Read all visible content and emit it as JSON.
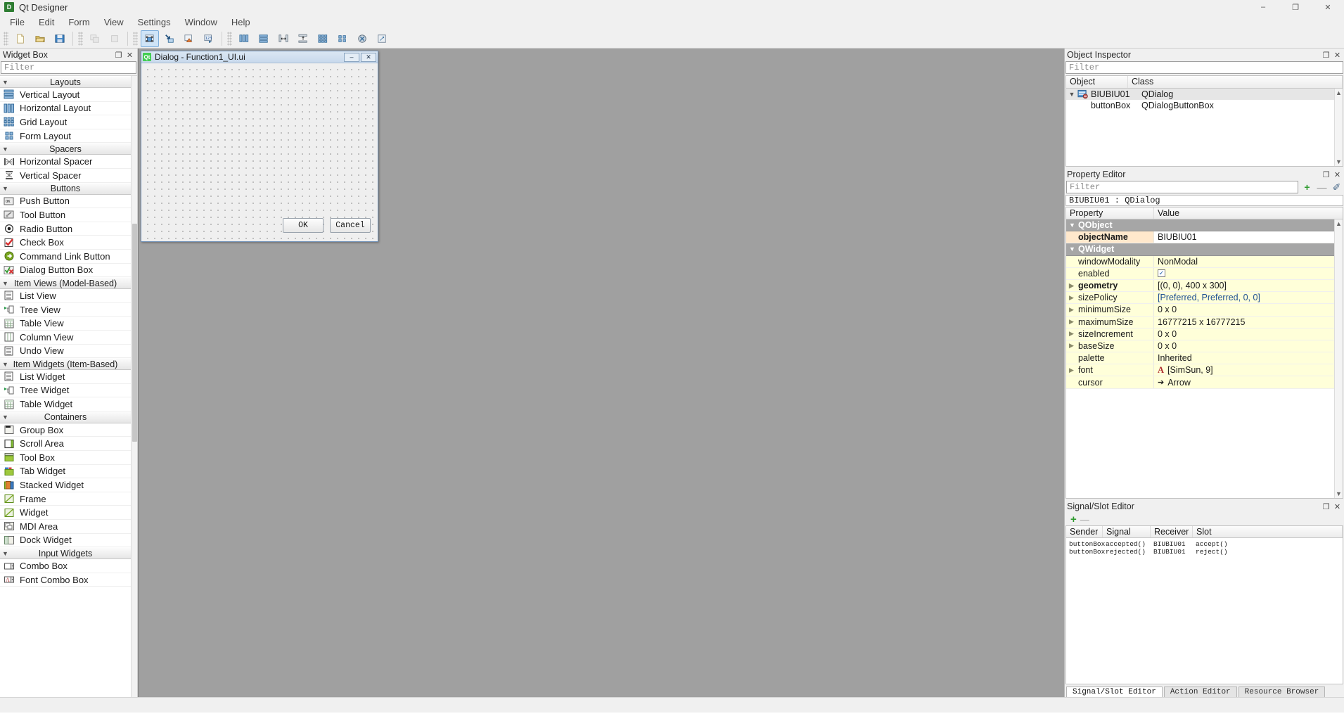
{
  "window": {
    "title": "Qt Designer",
    "icon": "qt-designer-icon",
    "badge_text": "D",
    "controls": {
      "minimize": "–",
      "maximize": "❐",
      "close": "✕"
    }
  },
  "menubar": {
    "items": [
      {
        "label": "File"
      },
      {
        "label": "Edit"
      },
      {
        "label": "Form"
      },
      {
        "label": "View"
      },
      {
        "label": "Settings"
      },
      {
        "label": "Window"
      },
      {
        "label": "Help"
      }
    ]
  },
  "toolbar": {
    "groups": [
      {
        "buttons": [
          {
            "name": "new-form-icon",
            "title": "New"
          },
          {
            "name": "open-form-icon",
            "title": "Open"
          },
          {
            "name": "save-form-icon",
            "title": "Save"
          }
        ]
      },
      {
        "buttons": [
          {
            "name": "undo-icon",
            "title": "Undo",
            "state": "disabled"
          },
          {
            "name": "redo-icon",
            "title": "Redo",
            "state": "disabled"
          }
        ]
      },
      {
        "buttons": [
          {
            "name": "edit-widgets-icon",
            "title": "Edit Widgets",
            "state": "active"
          },
          {
            "name": "edit-signals-slots-icon",
            "title": "Edit Signals/Slots"
          },
          {
            "name": "edit-buddies-icon",
            "title": "Edit Buddies"
          },
          {
            "name": "edit-tab-order-icon",
            "title": "Edit Tab Order"
          }
        ]
      },
      {
        "buttons": [
          {
            "name": "layout-horizontally-icon",
            "title": "Lay Out Horizontally"
          },
          {
            "name": "layout-vertically-icon",
            "title": "Lay Out Vertically"
          },
          {
            "name": "layout-splitter-horizontal-icon",
            "title": "Lay Out Horizontally in Splitter"
          },
          {
            "name": "layout-splitter-vertical-icon",
            "title": "Lay Out Vertically in Splitter"
          },
          {
            "name": "layout-grid-icon",
            "title": "Lay Out in a Grid"
          },
          {
            "name": "layout-form-icon",
            "title": "Lay Out in a Form Layout"
          },
          {
            "name": "break-layout-icon",
            "title": "Break Layout"
          },
          {
            "name": "adjust-size-icon",
            "title": "Adjust Size"
          }
        ]
      }
    ]
  },
  "widget_box": {
    "title": "Widget Box",
    "float_btn": "❐",
    "close_btn": "✕",
    "filter_placeholder": "Filter",
    "categories": [
      {
        "name": "Layouts",
        "expanded": true,
        "items": [
          {
            "label": "Vertical Layout",
            "icon": "vertical-layout-icon"
          },
          {
            "label": "Horizontal Layout",
            "icon": "horizontal-layout-icon"
          },
          {
            "label": "Grid Layout",
            "icon": "grid-layout-icon"
          },
          {
            "label": "Form Layout",
            "icon": "form-layout-icon"
          }
        ]
      },
      {
        "name": "Spacers",
        "expanded": true,
        "items": [
          {
            "label": "Horizontal Spacer",
            "icon": "horizontal-spacer-icon"
          },
          {
            "label": "Vertical Spacer",
            "icon": "vertical-spacer-icon"
          }
        ]
      },
      {
        "name": "Buttons",
        "expanded": true,
        "items": [
          {
            "label": "Push Button",
            "icon": "push-button-icon"
          },
          {
            "label": "Tool Button",
            "icon": "tool-button-icon"
          },
          {
            "label": "Radio Button",
            "icon": "radio-button-icon"
          },
          {
            "label": "Check Box",
            "icon": "check-box-icon"
          },
          {
            "label": "Command Link Button",
            "icon": "command-link-button-icon"
          },
          {
            "label": "Dialog Button Box",
            "icon": "dialog-button-box-icon"
          }
        ]
      },
      {
        "name": "Item Views (Model-Based)",
        "expanded": true,
        "items": [
          {
            "label": "List View",
            "icon": "list-view-icon"
          },
          {
            "label": "Tree View",
            "icon": "tree-view-icon"
          },
          {
            "label": "Table View",
            "icon": "table-view-icon"
          },
          {
            "label": "Column View",
            "icon": "column-view-icon"
          },
          {
            "label": "Undo View",
            "icon": "undo-view-icon"
          }
        ]
      },
      {
        "name": "Item Widgets (Item-Based)",
        "expanded": true,
        "items": [
          {
            "label": "List Widget",
            "icon": "list-widget-icon"
          },
          {
            "label": "Tree Widget",
            "icon": "tree-widget-icon"
          },
          {
            "label": "Table Widget",
            "icon": "table-widget-icon"
          }
        ]
      },
      {
        "name": "Containers",
        "expanded": true,
        "items": [
          {
            "label": "Group Box",
            "icon": "group-box-icon"
          },
          {
            "label": "Scroll Area",
            "icon": "scroll-area-icon"
          },
          {
            "label": "Tool Box",
            "icon": "tool-box-icon"
          },
          {
            "label": "Tab Widget",
            "icon": "tab-widget-icon"
          },
          {
            "label": "Stacked Widget",
            "icon": "stacked-widget-icon"
          },
          {
            "label": "Frame",
            "icon": "frame-icon"
          },
          {
            "label": "Widget",
            "icon": "widget-icon"
          },
          {
            "label": "MDI Area",
            "icon": "mdi-area-icon"
          },
          {
            "label": "Dock Widget",
            "icon": "dock-widget-icon"
          }
        ]
      },
      {
        "name": "Input Widgets",
        "expanded": true,
        "items": [
          {
            "label": "Combo Box",
            "icon": "combo-box-icon"
          },
          {
            "label": "Font Combo Box",
            "icon": "font-combo-box-icon"
          }
        ]
      }
    ]
  },
  "form_window": {
    "title": "Dialog - Function1_UI.ui",
    "badge": "Qt",
    "minimize_btn": "–",
    "close_btn": "✕",
    "buttons": [
      {
        "label": "OK",
        "name": "ok-button"
      },
      {
        "label": "Cancel",
        "name": "cancel-button"
      }
    ]
  },
  "object_inspector": {
    "title": "Object Inspector",
    "float_btn": "❐",
    "close_btn": "✕",
    "filter_placeholder": "Filter",
    "columns": [
      "Object",
      "Class"
    ],
    "rows": [
      {
        "object": "BIUBIU01",
        "class": "QDialog",
        "level": 0,
        "expanded": true,
        "selected": true,
        "icon": "qdialog-icon"
      },
      {
        "object": "buttonBox",
        "class": "QDialogButtonBox",
        "level": 1,
        "expanded": false,
        "selected": false,
        "icon": ""
      }
    ]
  },
  "property_editor": {
    "title": "Property Editor",
    "float_btn": "❐",
    "close_btn": "✕",
    "filter_placeholder": "Filter",
    "add_btn": "+",
    "remove_btn": "—",
    "config_btn": "✐",
    "object_header": "BIUBIU01 : QDialog",
    "columns": [
      "Property",
      "Value"
    ],
    "rows": [
      {
        "key": "QObject",
        "value": "",
        "type": "group",
        "expanded": true
      },
      {
        "key": "objectName",
        "value": "BIUBIU01",
        "type": "prop",
        "bold": true,
        "highlight": "peach"
      },
      {
        "key": "QWidget",
        "value": "",
        "type": "group",
        "expanded": true
      },
      {
        "key": "windowModality",
        "value": "NonModal",
        "type": "prop",
        "highlight": "yellow"
      },
      {
        "key": "enabled",
        "value": "",
        "type": "checkbox",
        "checked": true,
        "highlight": "yellow"
      },
      {
        "key": "geometry",
        "value": "[(0, 0), 400 x 300]",
        "type": "prop",
        "bold": true,
        "expandable": true,
        "highlight": "yellow"
      },
      {
        "key": "sizePolicy",
        "value": "[Preferred, Preferred, 0, 0]",
        "type": "prop",
        "expandable": true,
        "value_color": "blue",
        "highlight": "yellow"
      },
      {
        "key": "minimumSize",
        "value": "0 x 0",
        "type": "prop",
        "expandable": true,
        "highlight": "yellow"
      },
      {
        "key": "maximumSize",
        "value": "16777215 x 16777215",
        "type": "prop",
        "expandable": true,
        "highlight": "yellow"
      },
      {
        "key": "sizeIncrement",
        "value": "0 x 0",
        "type": "prop",
        "expandable": true,
        "highlight": "yellow"
      },
      {
        "key": "baseSize",
        "value": "0 x 0",
        "type": "prop",
        "expandable": true,
        "highlight": "yellow"
      },
      {
        "key": "palette",
        "value": "Inherited",
        "type": "prop",
        "highlight": "yellow"
      },
      {
        "key": "font",
        "value": "[SimSun, 9]",
        "type": "font",
        "expandable": true,
        "highlight": "yellow"
      },
      {
        "key": "cursor",
        "value": "Arrow",
        "type": "cursor",
        "highlight": "yellow"
      }
    ]
  },
  "signal_slot_editor": {
    "title": "Signal/Slot Editor",
    "float_btn": "❐",
    "close_btn": "✕",
    "add_btn": "+",
    "remove_btn": "—",
    "columns": [
      "Sender",
      "Signal",
      "Receiver",
      "Slot"
    ],
    "rows": [
      {
        "sender": "buttonBox",
        "signal": "accepted()",
        "receiver": "BIUBIU01",
        "slot": "accept()"
      },
      {
        "sender": "buttonBox",
        "signal": "rejected()",
        "receiver": "BIUBIU01",
        "slot": "reject()"
      }
    ],
    "tabs": [
      {
        "label": "Signal/Slot Editor",
        "active": true
      },
      {
        "label": "Action Editor",
        "active": false
      },
      {
        "label": "Resource Browser",
        "active": false
      }
    ]
  },
  "colors": {
    "accent": "#cfe4f7",
    "canvas_bg": "#a0a0a0",
    "panel_bg": "#f0f0f0",
    "property_group": "#a6a6a6",
    "property_yellow": "#ffffd9",
    "property_peach": "#ffe8cc",
    "qt_green": "#41cd52"
  }
}
